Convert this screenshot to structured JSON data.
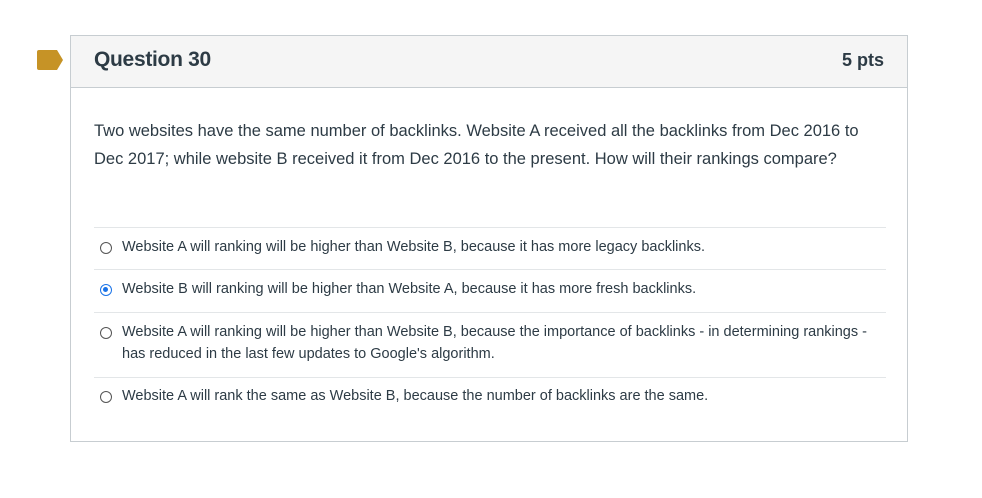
{
  "question": {
    "title": "Question 30",
    "points": "5 pts",
    "text": "Two websites have the same number of backlinks. Website A received all the backlinks from Dec 2016 to Dec 2017; while website B received it from Dec 2016 to the present.  How will their rankings compare?",
    "flag_color": "#c69326",
    "accent_color": "#1a73e8"
  },
  "answers": [
    {
      "label": "Website A will ranking will be higher than Website B, because it has more legacy backlinks.",
      "selected": false
    },
    {
      "label": "Website B will ranking will be higher than Website A, because it has more fresh backlinks.",
      "selected": true
    },
    {
      "label": "Website A will ranking will be higher than Website B, because the importance of backlinks - in determining rankings - has reduced in the last few updates to Google's algorithm.",
      "selected": false
    },
    {
      "label": "Website A will rank the same as Website B, because the number of backlinks are the same.",
      "selected": false
    }
  ]
}
